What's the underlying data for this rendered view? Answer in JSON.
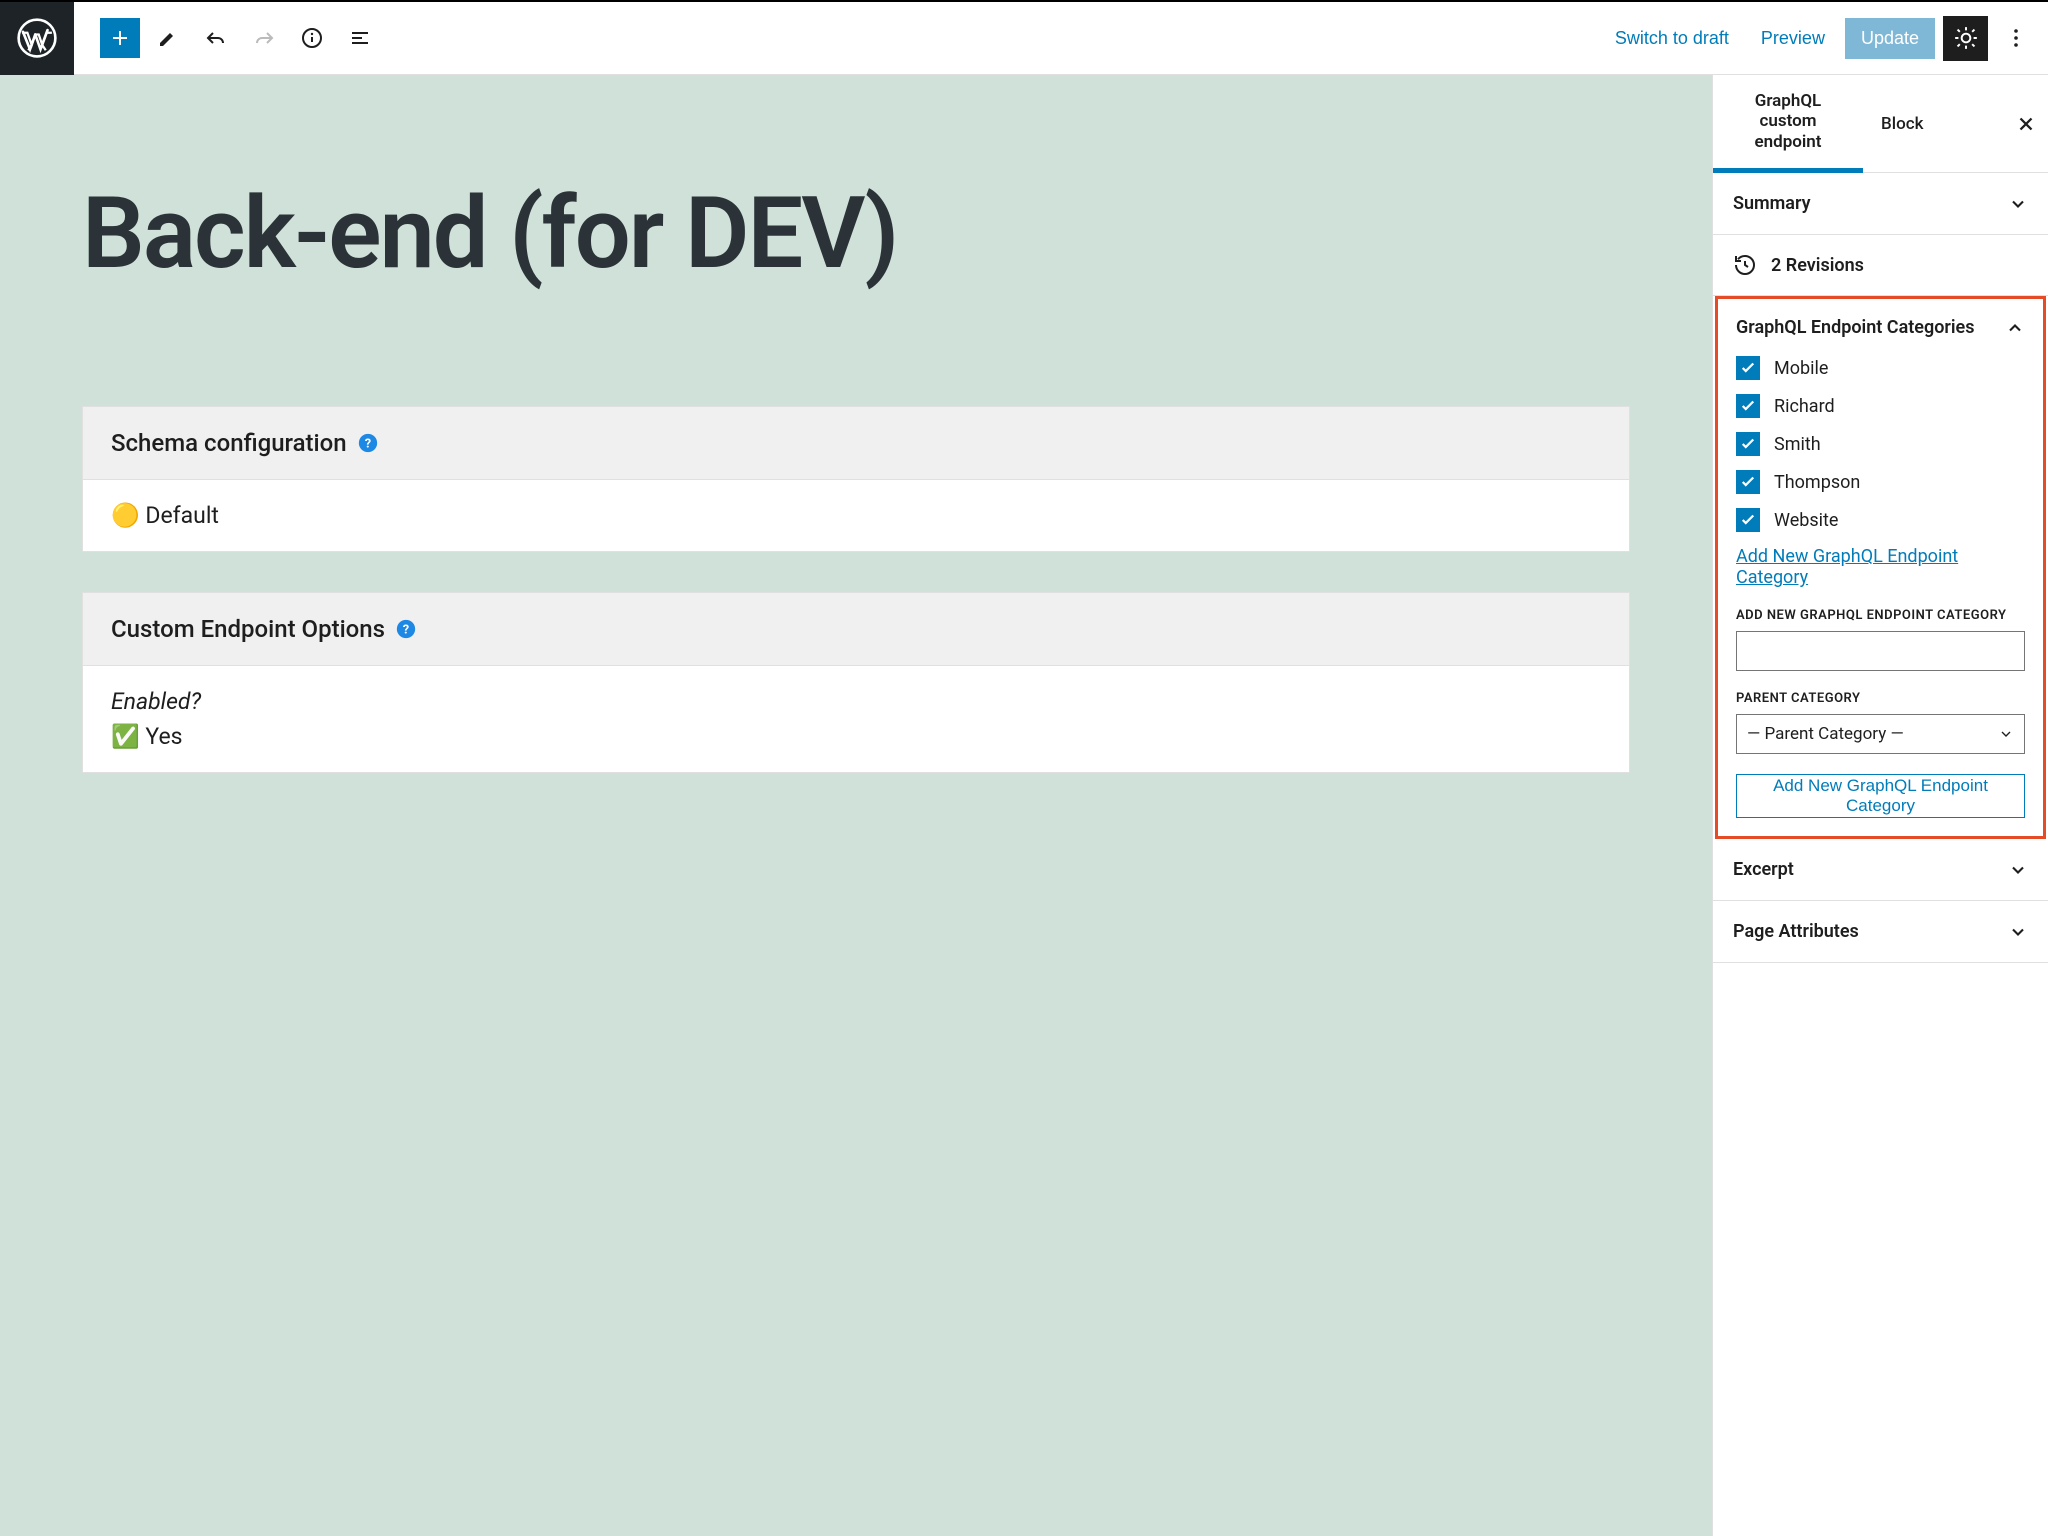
{
  "toolbar": {
    "switch_to_draft": "Switch to draft",
    "preview": "Preview",
    "update": "Update"
  },
  "editor": {
    "title": "Back-end (for DEV)",
    "panels": {
      "schema": {
        "title": "Schema configuration",
        "value_icon": "🟡",
        "value": "Default"
      },
      "options": {
        "title": "Custom Endpoint Options",
        "enabled_label": "Enabled?",
        "enabled_icon": "✅",
        "enabled_value": "Yes"
      }
    }
  },
  "sidebar": {
    "tabs": {
      "main": "GraphQL custom endpoint",
      "block": "Block"
    },
    "sections": {
      "summary": "Summary",
      "revisions": "2 Revisions",
      "categories": {
        "title": "GraphQL Endpoint Categories",
        "items": [
          "Mobile",
          "Richard",
          "Smith",
          "Thompson",
          "Website"
        ],
        "add_link": "Add New GraphQL Endpoint Category",
        "add_label": "ADD NEW GRAPHQL ENDPOINT CATEGORY",
        "parent_label": "PARENT CATEGORY",
        "parent_placeholder": "— Parent Category —",
        "add_button": "Add New GraphQL Endpoint Category"
      },
      "excerpt": "Excerpt",
      "page_attributes": "Page Attributes"
    }
  }
}
